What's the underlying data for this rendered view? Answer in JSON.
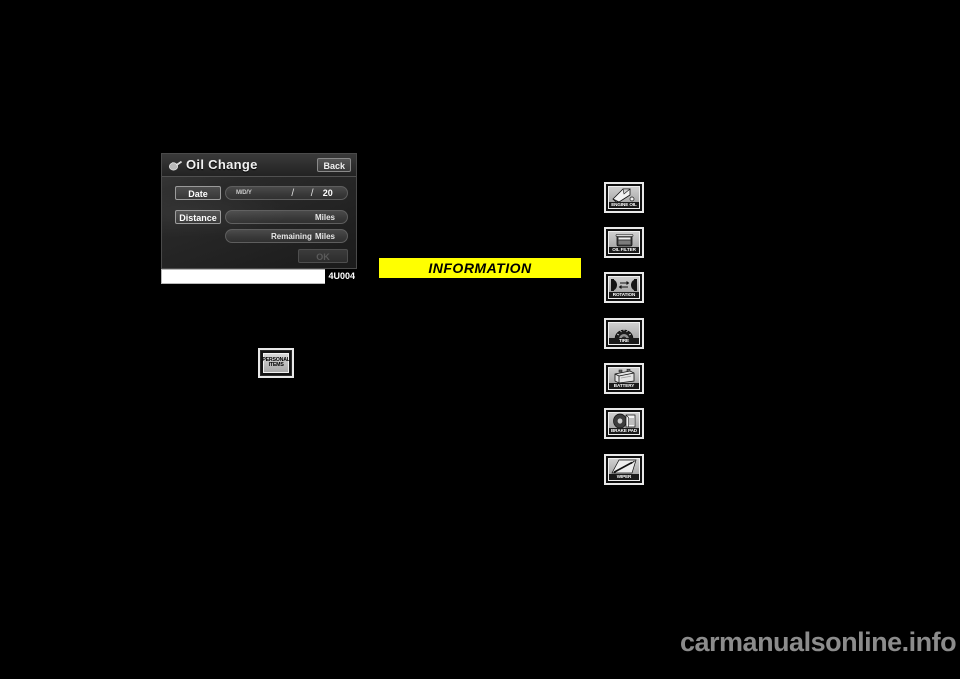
{
  "page": {
    "background_color": "#000000",
    "watermark": "carmanualsonline.info"
  },
  "nav_screen": {
    "figure_code": "4U004",
    "title": "Oil Change",
    "title_icon": "oil-can-icon",
    "back_label": "Back",
    "rows": [
      {
        "button_label": "Date",
        "format_hint": "M/D/Y",
        "separator_1": "/",
        "separator_2": "/",
        "year_prefix": "20"
      },
      {
        "button_label": "Distance",
        "unit": "Miles"
      },
      {
        "label": "Remaining",
        "unit": "Miles"
      }
    ],
    "ok_label": "OK",
    "ok_enabled": false
  },
  "information": {
    "heading": "INFORMATION",
    "background_color": "#ffff00",
    "text_color": "#000000"
  },
  "personal_items_button": {
    "line1": "PERSONAL",
    "line2": "ITEMS"
  },
  "maintenance_icons": [
    {
      "label": "ENGINE OIL",
      "icon": "engine-oil-icon"
    },
    {
      "label": "OIL FILTER",
      "icon": "oil-filter-icon"
    },
    {
      "label": "ROTATION",
      "icon": "tire-rotation-icon"
    },
    {
      "label": "TIRE",
      "icon": "tire-icon"
    },
    {
      "label": "BATTERY",
      "icon": "battery-icon"
    },
    {
      "label": "BRAKE PAD",
      "icon": "brake-pad-icon"
    },
    {
      "label": "WIPER",
      "icon": "wiper-icon"
    }
  ]
}
